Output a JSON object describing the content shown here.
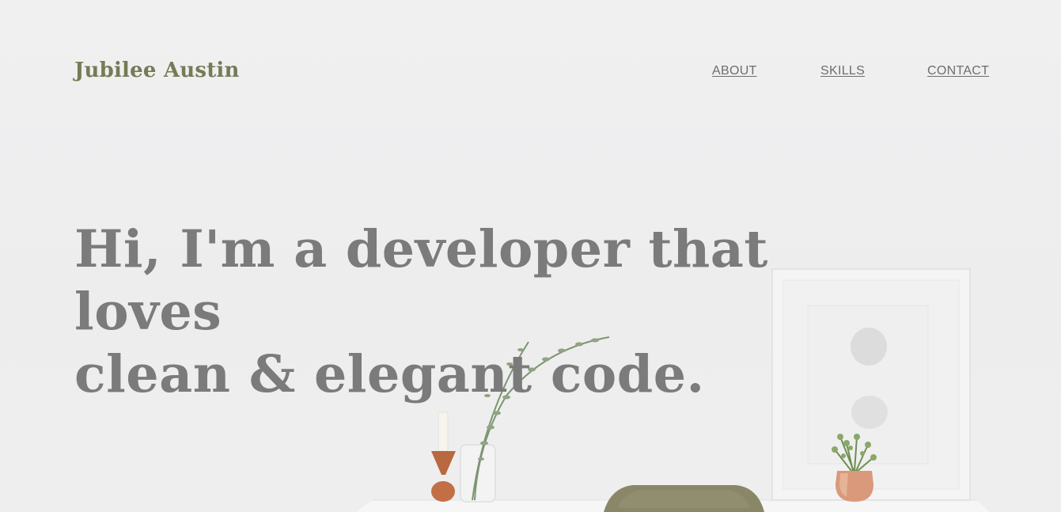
{
  "brand": {
    "name": "Jubilee Austin"
  },
  "nav": {
    "items": [
      {
        "label": "ABOUT"
      },
      {
        "label": "SKILLS"
      },
      {
        "label": "CONTACT"
      }
    ]
  },
  "hero": {
    "headline_line1": "Hi, I'm a developer that loves",
    "headline_line2": "clean & elegant code."
  },
  "colors": {
    "brand": "#757b56",
    "headline": "#7b7b7b",
    "nav_link": "#6d6d6d",
    "background": "#eeeeef"
  }
}
